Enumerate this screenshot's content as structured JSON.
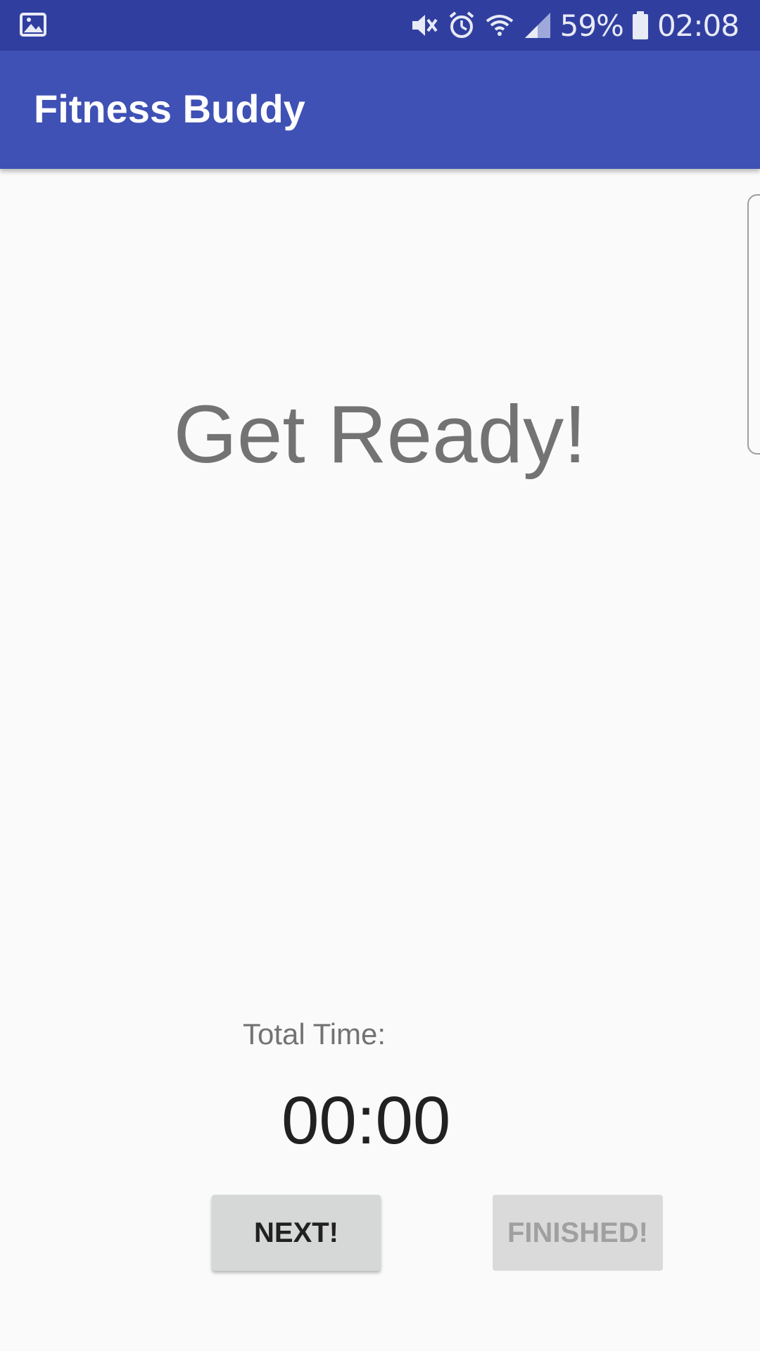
{
  "status_bar": {
    "battery_percent": "59%",
    "time": "02:08",
    "icons": [
      "image-notification-icon",
      "mute-icon",
      "alarm-icon",
      "wifi-icon",
      "signal-icon",
      "battery-icon"
    ]
  },
  "app_bar": {
    "title": "Fitness Buddy"
  },
  "main": {
    "headline": "Get Ready!",
    "total_time_label": "Total Time:",
    "timer_value": "00:00",
    "next_button": "NEXT!",
    "finished_button": "FINISHED!"
  },
  "colors": {
    "status_bar": "#303f9f",
    "app_bar": "#3f51b5",
    "background": "#fafafa",
    "button": "#d6d7d7"
  }
}
